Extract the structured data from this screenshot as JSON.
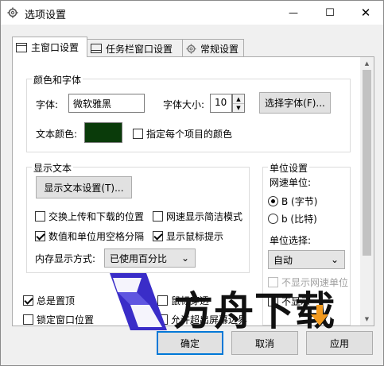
{
  "window": {
    "title": "选项设置",
    "close_glyph": "✕",
    "maximize_glyph": "☐",
    "minimize_glyph": "—"
  },
  "tabs": [
    {
      "label": "主窗口设置",
      "icon": "window-icon",
      "active": true
    },
    {
      "label": "任务栏窗口设置",
      "icon": "taskbar-icon",
      "active": false
    },
    {
      "label": "常规设置",
      "icon": "gear-icon",
      "active": false
    }
  ],
  "color_font": {
    "title": "颜色和字体",
    "font_label": "字体:",
    "font_value": "微软雅黑",
    "size_label": "字体大小:",
    "size_value": "10",
    "choose_font_button": "选择字体(F)...",
    "text_color_label": "文本颜色:",
    "text_color": "#0a3b0a",
    "per_item_color_label": "指定每个项目的颜色"
  },
  "display_text": {
    "title": "显示文本",
    "settings_button": "显示文本设置(T)...",
    "options": [
      {
        "label": "交换上传和下载的位置",
        "checked": false
      },
      {
        "label": "网速显示简洁模式",
        "checked": false
      },
      {
        "label": "数值和单位用空格分隔",
        "checked": true
      },
      {
        "label": "显示鼠标提示",
        "checked": true
      }
    ],
    "memory_label": "内存显示方式:",
    "memory_value": "已使用百分比"
  },
  "unit": {
    "title": "单位设置",
    "speed_unit_label": "网速单位:",
    "speed_units": [
      {
        "label": "B (字节)",
        "checked": true
      },
      {
        "label": "b (比特)",
        "checked": false
      }
    ],
    "unit_select_label": "单位选择:",
    "unit_select_value": "自动",
    "hide_speed_unit_label": "不显示网速单位",
    "hide_percent_label": "不显示"
  },
  "bottom_options": [
    {
      "label": "总是置顶",
      "checked": true
    },
    {
      "label": "锁定窗口位置",
      "checked": false
    },
    {
      "label": "鼠标穿透",
      "checked": false
    },
    {
      "label": "允许超出屏幕边界",
      "checked": false
    }
  ],
  "buttons": {
    "ok": "确定",
    "cancel": "取消",
    "apply": "应用"
  },
  "watermark": {
    "text": "方舟下载"
  }
}
